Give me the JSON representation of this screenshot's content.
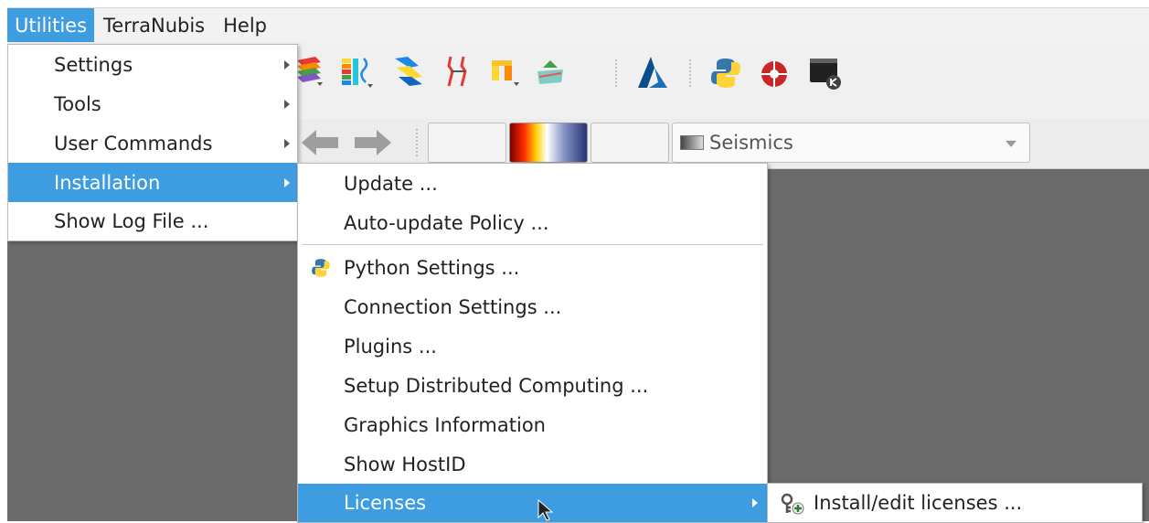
{
  "menubar": {
    "items": [
      "Utilities",
      "TerraNubis",
      "Help"
    ]
  },
  "toolbar": {
    "icons": [
      "layers-icon",
      "log-bars-icon",
      "horizon-icon",
      "fault-icon",
      "well-icon",
      "attribute-icon",
      "azure-icon",
      "python-icon",
      "network-icon",
      "terminal-icon"
    ],
    "seismics_label": "Seismics"
  },
  "utilities_menu": {
    "items": [
      {
        "label": "Settings",
        "submenu": true
      },
      {
        "label": "Tools",
        "submenu": true
      },
      {
        "label": "User Commands",
        "submenu": true
      },
      {
        "label": "Installation",
        "submenu": true
      },
      {
        "label": "Show Log File ...",
        "submenu": false
      }
    ]
  },
  "installation_menu": {
    "items": [
      {
        "label": "Update ..."
      },
      {
        "label": "Auto-update Policy ..."
      },
      {
        "label": "Python Settings ...",
        "icon": "python-icon"
      },
      {
        "label": "Connection Settings ..."
      },
      {
        "label": "Plugins ..."
      },
      {
        "label": "Setup Distributed Computing ..."
      },
      {
        "label": "Graphics Information"
      },
      {
        "label": "Show HostID"
      },
      {
        "label": "Licenses",
        "submenu": true
      }
    ]
  },
  "licenses_menu": {
    "items": [
      {
        "label": "Install/edit licenses ...",
        "icon": "license-key-icon"
      }
    ]
  },
  "colors": {
    "highlight": "#3d9de0",
    "workspace": "#6b6b6b"
  }
}
